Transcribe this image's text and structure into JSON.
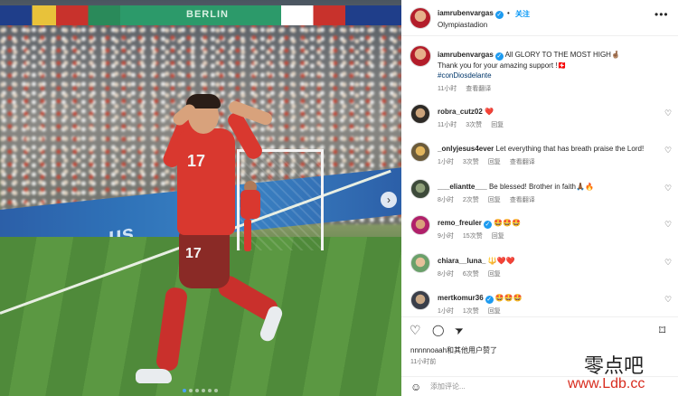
{
  "photo": {
    "banner_text": "BERLIN",
    "boards_text": "us",
    "jersey_number": "17",
    "next_icon": "›",
    "carousel_count": 6,
    "carousel_active": 0
  },
  "post_header": {
    "username": "iamrubenvargas",
    "verified_icon": "✓",
    "separator": "•",
    "follow_label": "关注",
    "location": "Olympiastadion",
    "more_icon": "•••"
  },
  "caption": {
    "username": "iamrubenvargas",
    "line1": "All GLORY TO THE MOST HIGH🤞🏽",
    "line2": "Thank you for your amazing support !🇨🇭",
    "hashtag": "#conDiosdelante",
    "time": "11小时",
    "translate": "查看翻译"
  },
  "comments": [
    {
      "username": "robra_cutz02",
      "text": "❤️",
      "time": "11小时",
      "likes": "3次赞",
      "reply": "回复",
      "translate": ""
    },
    {
      "username": "_onlyjesus4ever",
      "text": "Let everything that has breath praise the Lord!",
      "time": "1小时",
      "likes": "3次赞",
      "reply": "回复",
      "translate": "查看翻译"
    },
    {
      "username": "___eliantte___",
      "text": "Be blessed! Brother in faith🙏🏾🔥",
      "time": "8小时",
      "likes": "2次赞",
      "reply": "回复",
      "translate": "查看翻译"
    },
    {
      "username": "remo_freuler",
      "text": "🤩🤩🤩",
      "time": "9小时",
      "likes": "15次赞",
      "reply": "回复",
      "translate": ""
    },
    {
      "username": "chiara__luna_",
      "text": "🔱❤️❤️",
      "time": "8小时",
      "likes": "6次赞",
      "reply": "回复",
      "translate": ""
    },
    {
      "username": "mertkomur36",
      "text": "🤩🤩🤩",
      "time": "1小时",
      "likes": "1次赞",
      "reply": "回复",
      "translate": ""
    }
  ],
  "actions": {
    "like_icon": "♡",
    "comment_icon": "◯",
    "share_icon": "➤",
    "save_icon": "⌑",
    "liked_by": "nnnnnoaah和其他用户赞了",
    "time": "11小时前"
  },
  "add_comment": {
    "emoji_icon": "☺",
    "placeholder": "添加评论..."
  },
  "watermark": {
    "text": "零点吧",
    "url": "www.Ldb.cc"
  }
}
